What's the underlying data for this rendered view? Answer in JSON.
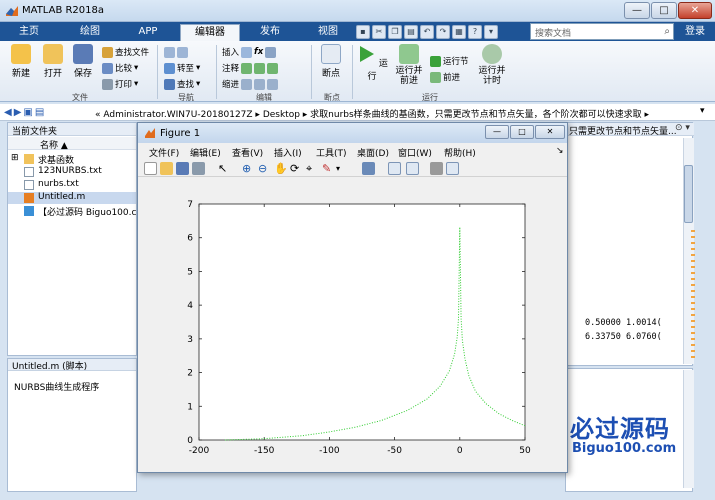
{
  "titlebar": {
    "title": "MATLAB R2018a",
    "min": "—",
    "max": "□",
    "close": "✕"
  },
  "tabs": [
    {
      "label": "主页"
    },
    {
      "label": "绘图"
    },
    {
      "label": "APP"
    },
    {
      "label": "编辑器",
      "active": true
    },
    {
      "label": "发布"
    },
    {
      "label": "视图"
    }
  ],
  "search": {
    "placeholder": "搜索文档"
  },
  "login": "登录",
  "ribbon": {
    "new": "新建",
    "open": "打开",
    "save": "保存",
    "find_files": "查找文件",
    "compare": "比较",
    "print": "打印",
    "goto": "转至",
    "find": "查找",
    "insert": "插入",
    "comment": "注释",
    "indent": "缩进",
    "breakpoints": "断点",
    "run": "运行",
    "run_advance": "运行并\n前进",
    "run_section": "运行节",
    "advance": "前进",
    "run_time": "运行并\n计时",
    "groups": {
      "file": "文件",
      "navigate": "导航",
      "edit": "编辑",
      "breakpoints": "断点",
      "run": "运行"
    }
  },
  "address": {
    "path": "« Administrator.WIN7U-20180127Z  ▸  Desktop  ▸  求取nurbs样条曲线的基函数，只需更改节点和节点矢量，各个阶次都可以快速求取  ▸"
  },
  "files": {
    "header": "当前文件夹",
    "col_name": "名称 ▲",
    "items": [
      {
        "name": "求基函数",
        "type": "folder"
      },
      {
        "name": "123NURBS.txt",
        "type": "txt"
      },
      {
        "name": "nurbs.txt",
        "type": "txt"
      },
      {
        "name": "Untitled.m",
        "type": "m",
        "selected": true
      },
      {
        "name": "【必过源码 Biguo100.com】",
        "type": "link"
      }
    ]
  },
  "details": {
    "header": "Untitled.m  (脚本)",
    "text": "NURBS曲线生成程序"
  },
  "rightpanel": {
    "header": "只需更改节点和节点矢量...",
    "line1": "0.50000    1.0014(",
    "line2": "6.33750    6.0760("
  },
  "watermark": {
    "t1": "必过源码",
    "t2": "Biguo100.com"
  },
  "figure": {
    "title": "Figure 1",
    "menus": [
      "文件(F)",
      "编辑(E)",
      "查看(V)",
      "插入(I)",
      "工具(T)",
      "桌面(D)",
      "窗口(W)",
      "帮助(H)"
    ],
    "min": "—",
    "max": "□",
    "close": "✕"
  },
  "chart_data": {
    "type": "line",
    "title": "",
    "xlabel": "",
    "ylabel": "",
    "xlim": [
      -200,
      50
    ],
    "ylim": [
      0,
      7
    ],
    "xticks": [
      -200,
      -150,
      -100,
      -50,
      0,
      50
    ],
    "yticks": [
      0,
      1,
      2,
      3,
      4,
      5,
      6,
      7
    ],
    "grid": false,
    "series": [
      {
        "color": "#2ecc2e",
        "style": "dotted",
        "x": [
          -180,
          -150,
          -120,
          -100,
          -80,
          -60,
          -40,
          -25,
          -15,
          -8,
          -4,
          -2,
          -1,
          0
        ],
        "y": [
          0,
          0.04,
          0.13,
          0.24,
          0.38,
          0.58,
          0.88,
          1.22,
          1.6,
          2.05,
          2.55,
          3.05,
          3.6,
          6.3
        ]
      },
      {
        "color": "#2ecc2e",
        "style": "dotted",
        "x": [
          0,
          1,
          2,
          4,
          7,
          12,
          20,
          30,
          40,
          50
        ],
        "y": [
          6.3,
          3.6,
          2.95,
          2.4,
          1.9,
          1.45,
          1.08,
          0.78,
          0.58,
          0.42
        ]
      }
    ]
  }
}
